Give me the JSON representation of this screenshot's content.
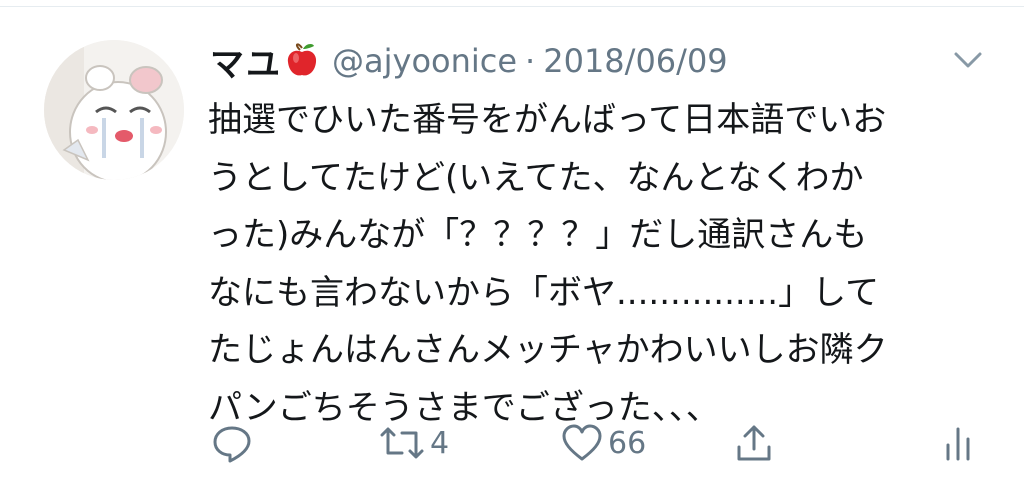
{
  "tweet": {
    "display_name": "マユ",
    "handle": "@ajyoonice",
    "separator": "·",
    "date": "2018/06/09",
    "lines": [
      "抽選でひいた番号をがんばって日本語でいお",
      "うとしてたけど(いえてた、なんとなくわか",
      "った)みんなが「？？？？」だし通訳さんも",
      "なにも言わないから「ボヤ...............」して",
      "たじょんはんさんメッチャかわいいしお隣ク",
      "パンごちそうさまでござった、、、"
    ]
  },
  "icons": {
    "name_emoji": "red-apple-icon",
    "menu": "chevron-down-icon",
    "reply": "reply-icon",
    "retweet": "retweet-icon",
    "like": "heart-icon",
    "share": "share-icon",
    "analytics": "analytics-icon"
  },
  "actions": {
    "retweet_count": "4",
    "like_count": "66"
  },
  "colors": {
    "text": "#14171a",
    "secondary": "#657786",
    "apple": "#e0252b"
  }
}
